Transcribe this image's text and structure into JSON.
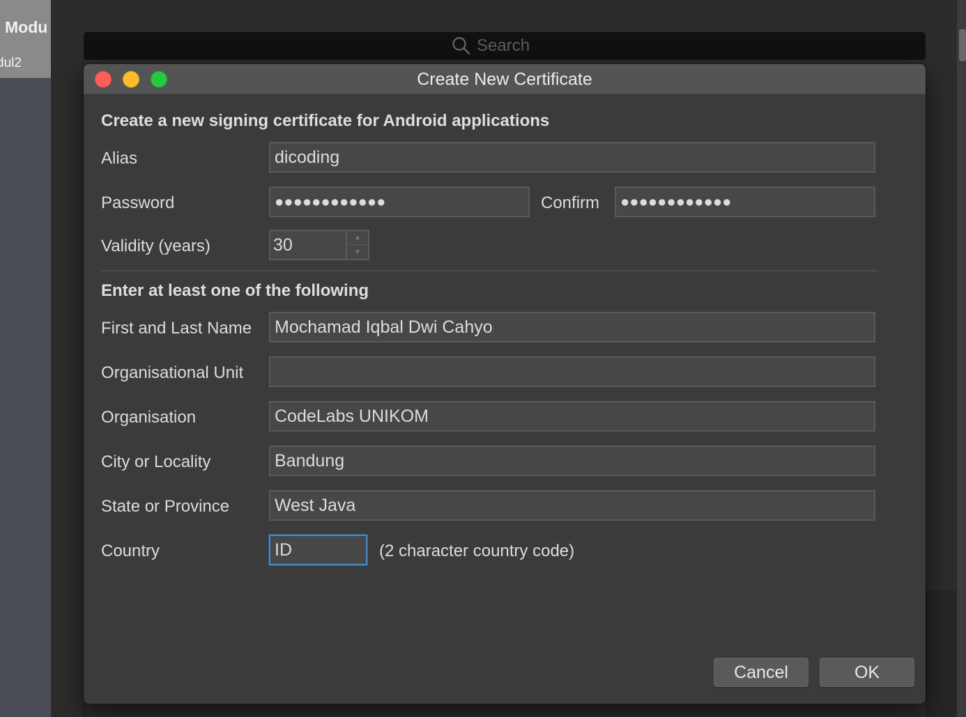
{
  "background": {
    "module_title": "Modu",
    "module_sub": "dul2",
    "search_placeholder": "Search"
  },
  "dialog": {
    "title": "Create New Certificate",
    "heading": "Create a new signing certificate for Android applications",
    "alias": {
      "label": "Alias",
      "value": "dicoding"
    },
    "password": {
      "label": "Password",
      "value": "●●●●●●●●●●●●"
    },
    "confirm": {
      "label": "Confirm",
      "value": "●●●●●●●●●●●●"
    },
    "validity": {
      "label": "Validity (years)",
      "value": "30"
    },
    "section2_heading": "Enter at least one of the following",
    "name": {
      "label": "First and Last Name",
      "value": "Mochamad Iqbal Dwi Cahyo"
    },
    "org_unit": {
      "label": "Organisational Unit",
      "value": ""
    },
    "organisation": {
      "label": "Organisation",
      "value": "CodeLabs UNIKOM"
    },
    "city": {
      "label": "City or Locality",
      "value": "Bandung"
    },
    "state": {
      "label": "State or Province",
      "value": "West Java"
    },
    "country": {
      "label": "Country",
      "value": "ID",
      "hint": "(2 character country code)"
    },
    "cancel_label": "Cancel",
    "ok_label": "OK"
  },
  "colors": {
    "close": "#fc5f57",
    "minimize": "#fdbc2e",
    "maximize": "#28c840",
    "focus": "#4a88c7"
  }
}
